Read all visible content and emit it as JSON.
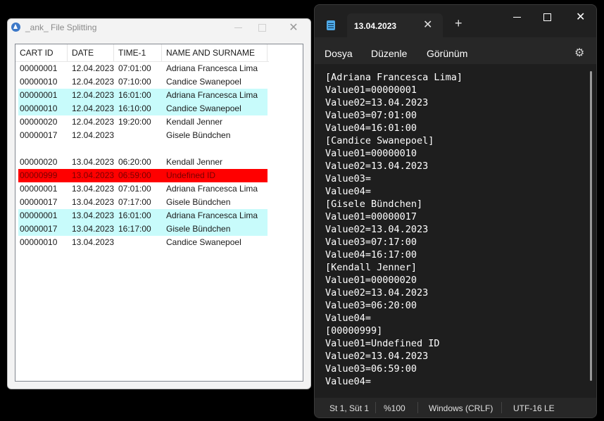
{
  "left_window": {
    "title": "_ank_ File Splitting",
    "min_symbol": "",
    "max_symbol": "",
    "close_symbol": "✕",
    "columns": [
      "CART ID",
      "DATE",
      "TIME-1",
      "NAME AND SURNAME"
    ],
    "rows": [
      {
        "id": "00000001",
        "date": "12.04.2023",
        "time": "07:01:00",
        "name": "Adriana Francesca Lima",
        "style": "normal"
      },
      {
        "id": "00000010",
        "date": "12.04.2023",
        "time": "07:10:00",
        "name": "Candice Swanepoel",
        "style": "normal"
      },
      {
        "id": "00000001",
        "date": "12.04.2023",
        "time": "16:01:00",
        "name": "Adriana Francesca Lima",
        "style": "highlight"
      },
      {
        "id": "00000010",
        "date": "12.04.2023",
        "time": "16:10:00",
        "name": "Candice Swanepoel",
        "style": "highlight"
      },
      {
        "id": "00000020",
        "date": "12.04.2023",
        "time": "19:20:00",
        "name": "Kendall Jenner",
        "style": "normal"
      },
      {
        "id": "00000017",
        "date": "12.04.2023",
        "time": "",
        "name": "Gisele Bündchen",
        "style": "normal"
      },
      {
        "id": "",
        "date": "",
        "time": "",
        "name": "",
        "style": "blank"
      },
      {
        "id": "00000020",
        "date": "13.04.2023",
        "time": "06:20:00",
        "name": "Kendall Jenner",
        "style": "normal"
      },
      {
        "id": "00000999",
        "date": "13.04.2023",
        "time": "06:59:00",
        "name": "Undefined ID",
        "style": "error"
      },
      {
        "id": "00000001",
        "date": "13.04.2023",
        "time": "07:01:00",
        "name": "Adriana Francesca Lima",
        "style": "normal"
      },
      {
        "id": "00000017",
        "date": "13.04.2023",
        "time": "07:17:00",
        "name": "Gisele Bündchen",
        "style": "normal"
      },
      {
        "id": "00000001",
        "date": "13.04.2023",
        "time": "16:01:00",
        "name": "Adriana Francesca Lima",
        "style": "highlight"
      },
      {
        "id": "00000017",
        "date": "13.04.2023",
        "time": "16:17:00",
        "name": "Gisele Bündchen",
        "style": "highlight"
      },
      {
        "id": "00000010",
        "date": "13.04.2023",
        "time": "",
        "name": "Candice Swanepoel",
        "style": "normal"
      }
    ],
    "colors": {
      "highlight": "#c8fbfb",
      "error": "#ff0000"
    }
  },
  "notepad": {
    "tab_title": "13.04.2023",
    "tab_close": "✕",
    "new_tab": "+",
    "close_symbol": "✕",
    "menu": [
      "Dosya",
      "Düzenle",
      "Görünüm"
    ],
    "settings_icon": "⚙",
    "lines": [
      "[Adriana Francesca Lima]",
      "Value01=00000001",
      "Value02=13.04.2023",
      "Value03=07:01:00",
      "Value04=16:01:00",
      "[Candice Swanepoel]",
      "Value01=00000010",
      "Value02=13.04.2023",
      "Value03=",
      "Value04=",
      "[Gisele Bündchen]",
      "Value01=00000017",
      "Value02=13.04.2023",
      "Value03=07:17:00",
      "Value04=16:17:00",
      "[Kendall Jenner]",
      "Value01=00000020",
      "Value02=13.04.2023",
      "Value03=06:20:00",
      "Value04=",
      "[00000999]",
      "Value01=Undefined ID",
      "Value02=13.04.2023",
      "Value03=06:59:00",
      "Value04="
    ],
    "status": {
      "position": "St 1, Süt 1",
      "zoom": "%100",
      "line_ending": "Windows (CRLF)",
      "encoding": "UTF-16 LE"
    }
  }
}
